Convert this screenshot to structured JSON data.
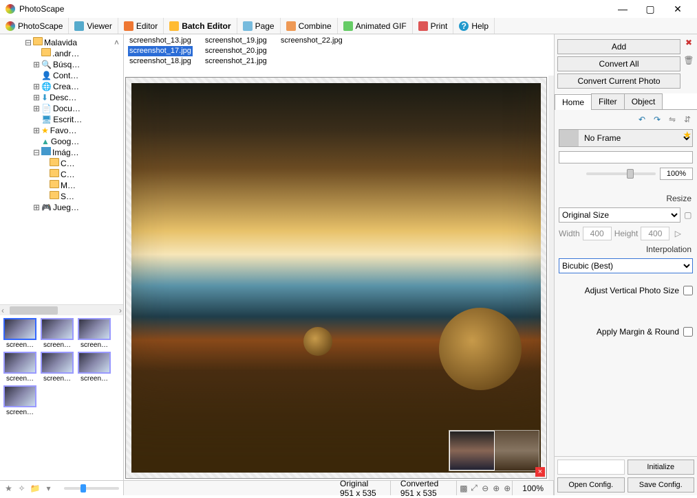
{
  "app": {
    "title": "PhotoScape"
  },
  "window_controls": {
    "min": "—",
    "max": "▢",
    "close": "✕"
  },
  "toolbar": [
    {
      "id": "photoscape",
      "label": "PhotoScape"
    },
    {
      "id": "viewer",
      "label": "Viewer"
    },
    {
      "id": "editor",
      "label": "Editor"
    },
    {
      "id": "batch",
      "label": "Batch Editor",
      "active": true
    },
    {
      "id": "page",
      "label": "Page"
    },
    {
      "id": "combine",
      "label": "Combine"
    },
    {
      "id": "gif",
      "label": "Animated GIF"
    },
    {
      "id": "print",
      "label": "Print"
    },
    {
      "id": "help",
      "label": "Help"
    }
  ],
  "tree": [
    {
      "indent": 3,
      "tw": "⊟",
      "icon": "folder",
      "label": "Malavida",
      "caret": "˄"
    },
    {
      "indent": 4,
      "tw": "",
      "icon": "folder",
      "label": ".andr…"
    },
    {
      "indent": 4,
      "tw": "⊞",
      "icon": "search",
      "label": "Búsq…"
    },
    {
      "indent": 4,
      "tw": "",
      "icon": "contact",
      "label": "Cont…"
    },
    {
      "indent": 4,
      "tw": "⊞",
      "icon": "globe",
      "label": "Crea…"
    },
    {
      "indent": 4,
      "tw": "⊞",
      "icon": "down",
      "label": "Desc…"
    },
    {
      "indent": 4,
      "tw": "⊞",
      "icon": "doc",
      "label": "Docu…"
    },
    {
      "indent": 4,
      "tw": "",
      "icon": "desk",
      "label": "Escrit…"
    },
    {
      "indent": 4,
      "tw": "⊞",
      "icon": "star",
      "label": "Favo…"
    },
    {
      "indent": 4,
      "tw": "",
      "icon": "cloud",
      "label": "Goog…"
    },
    {
      "indent": 4,
      "tw": "⊟",
      "icon": "pic",
      "label": "Imág…"
    },
    {
      "indent": 5,
      "tw": "",
      "icon": "folder",
      "label": "C…"
    },
    {
      "indent": 5,
      "tw": "",
      "icon": "folder",
      "label": "C…"
    },
    {
      "indent": 5,
      "tw": "",
      "icon": "folder",
      "label": "M…"
    },
    {
      "indent": 5,
      "tw": "",
      "icon": "folder",
      "label": "S…"
    },
    {
      "indent": 4,
      "tw": "⊞",
      "icon": "game",
      "label": "Jueg…"
    }
  ],
  "thumbs": [
    "screen…",
    "screen…",
    "screen…",
    "screen…",
    "screen…",
    "screen…",
    "screen…"
  ],
  "files": {
    "col1": [
      "screenshot_13.jpg",
      "screenshot_17.jpg",
      "screenshot_18.jpg",
      "screenshot_19.jpg"
    ],
    "col2": [
      "screenshot_20.jpg",
      "screenshot_21.jpg",
      "screenshot_22.jpg"
    ],
    "selected": "screenshot_17.jpg"
  },
  "status": {
    "original": "Original 951 x 535",
    "converted": "Converted 951 x 535",
    "zoom": "100%"
  },
  "right": {
    "buttons": {
      "add": "Add",
      "convert_all": "Convert All",
      "convert_current": "Convert Current Photo"
    },
    "tabs": [
      "Home",
      "Filter",
      "Object"
    ],
    "active_tab": "Home",
    "frame": {
      "label": "No Frame",
      "pct": "100%"
    },
    "resize": {
      "title": "Resize",
      "mode": "Original Size",
      "width_label": "Width",
      "width": "400",
      "height_label": "Height",
      "height": "400",
      "interp_title": "Interpolation",
      "interp": "Bicubic (Best)",
      "adjust_v": "Adjust Vertical Photo Size",
      "apply_margin": "Apply Margin & Round"
    },
    "bottom": {
      "initialize": "Initialize",
      "open": "Open Config.",
      "save": "Save Config."
    }
  }
}
